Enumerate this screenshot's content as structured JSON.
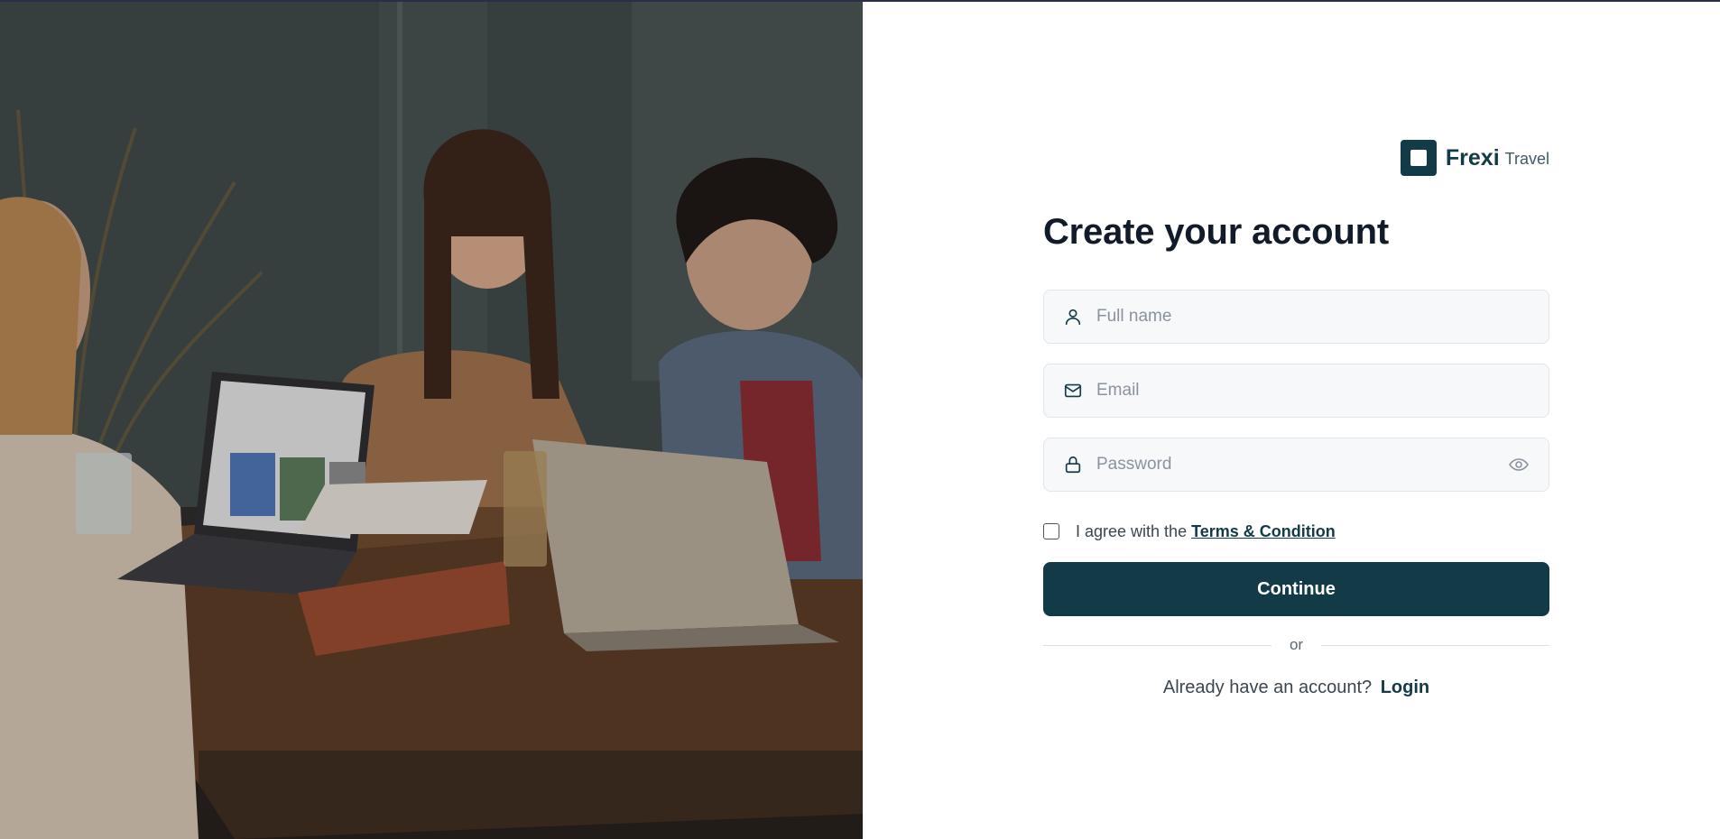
{
  "photo": {
    "description_icon": "photo-illustration"
  },
  "brand": {
    "name": "Frexi",
    "sub": "Travel",
    "color": "#133a47"
  },
  "form": {
    "title": "Create your account",
    "fullname": {
      "placeholder": "Full name",
      "value": "",
      "icon": "user-icon"
    },
    "email": {
      "placeholder": "Email",
      "value": "",
      "icon": "mail-icon"
    },
    "password": {
      "placeholder": "Password",
      "value": "",
      "icon": "lock-icon",
      "toggle_icon": "eye-icon"
    },
    "agree_text": "I agree with the",
    "terms_link": "Terms & Condition",
    "agree_checked": false,
    "continue_label": "Continue",
    "divider_text": "or",
    "login_prompt": "Already have an account?",
    "login_link": "Login"
  },
  "colors": {
    "accent": "#133a47",
    "field_bg": "#f7f8fa",
    "field_border": "#e3e6ea",
    "title": "#111b2a"
  }
}
